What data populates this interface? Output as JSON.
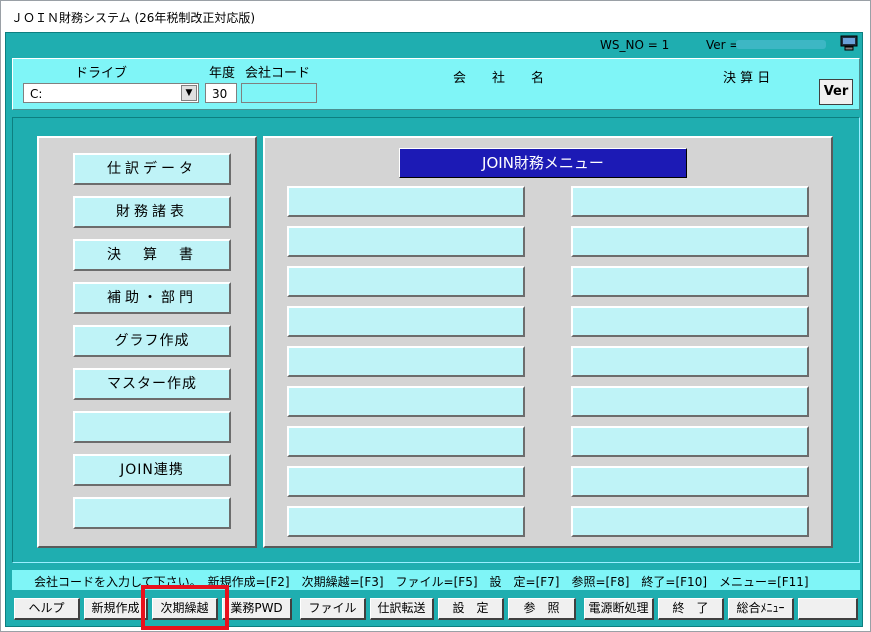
{
  "window": {
    "title": "ＪＯＩＮ財務システム (26年税制改正対応版)"
  },
  "status_row": {
    "ws_no": "WS_NO = 1",
    "ver_label": "Ver ="
  },
  "header": {
    "drive_label": "ドライブ",
    "drive_value": "C:",
    "year_label": "年度",
    "year_value": "30",
    "company_code_label": "会社コード",
    "company_code_value": "",
    "company_name_label": "会　　社　　名",
    "closing_date_label": "決 算 日",
    "ver_button": "Ver"
  },
  "left_menu": {
    "items": [
      {
        "label": "仕訳データ"
      },
      {
        "label": "財務諸表"
      },
      {
        "label": "決　算　書"
      },
      {
        "label": "補助・部門"
      },
      {
        "label": "グラフ作成"
      },
      {
        "label": "マスター作成"
      },
      {
        "label": ""
      },
      {
        "label": "JOIN連携"
      },
      {
        "label": ""
      }
    ]
  },
  "right_menu": {
    "title": "JOIN財務メニュー",
    "left_col": [
      "",
      "",
      "",
      "",
      "",
      "",
      "",
      "",
      ""
    ],
    "right_col": [
      "",
      "",
      "",
      "",
      "",
      "",
      "",
      "",
      ""
    ]
  },
  "status_bar": {
    "message": "会社コードを入力して下さい。　新規作成=[F2]　次期繰越=[F3]　ファイル=[F5]　設　定=[F7]　参照=[F8]　終了=[F10]　メニュー=[F11]"
  },
  "function_keys": [
    {
      "label": "ヘルプ"
    },
    {
      "label": "新規作成"
    },
    {
      "label": "次期繰越"
    },
    {
      "label": "業務PWD"
    },
    {
      "label": "ファイル"
    },
    {
      "label": "仕訳転送"
    },
    {
      "label": "設　定"
    },
    {
      "label": "参　照"
    },
    {
      "label": "電源断処理"
    },
    {
      "label": "終　了"
    },
    {
      "label": "総合ﾒﾆｭｰ"
    },
    {
      "label": ""
    }
  ],
  "colors": {
    "accent": "#1faeb0",
    "panel": "#7ff5f7",
    "menu_title": "#1c1ab5",
    "highlight": "#e8111d"
  }
}
